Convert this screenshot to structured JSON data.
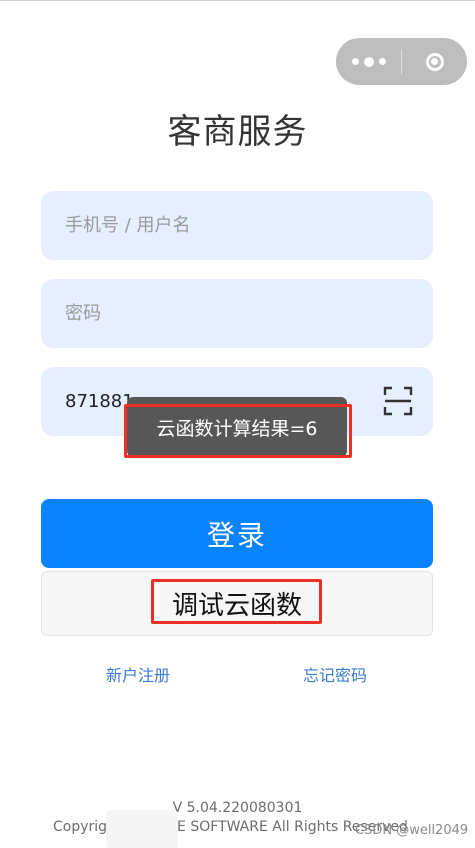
{
  "app": {
    "title": "客商服务"
  },
  "capsule": {
    "menu_icon": "more-dots-icon",
    "close_icon": "target-circle-icon"
  },
  "form": {
    "username": {
      "placeholder": "手机号 / 用户名",
      "value": ""
    },
    "password": {
      "placeholder": "密码",
      "value": ""
    },
    "captcha": {
      "value": "871881",
      "scan_icon": "scan-icon"
    }
  },
  "toast": {
    "text": "云函数计算结果=6"
  },
  "buttons": {
    "login_label": "登录",
    "debug_label": "调试云函数"
  },
  "links": {
    "register": "新户注册",
    "forgot": "忘记密码"
  },
  "footer": {
    "version": "V 5.04.220080301",
    "copyright_left": "Copyrig",
    "copyright_right": "E SOFTWARE All Rights Reserved",
    "watermark": "CSDN @well2049"
  },
  "colors": {
    "primary": "#0a83ff",
    "field_bg": "#e5efff",
    "highlight": "#ee2f24",
    "toast_bg": "#575757"
  }
}
